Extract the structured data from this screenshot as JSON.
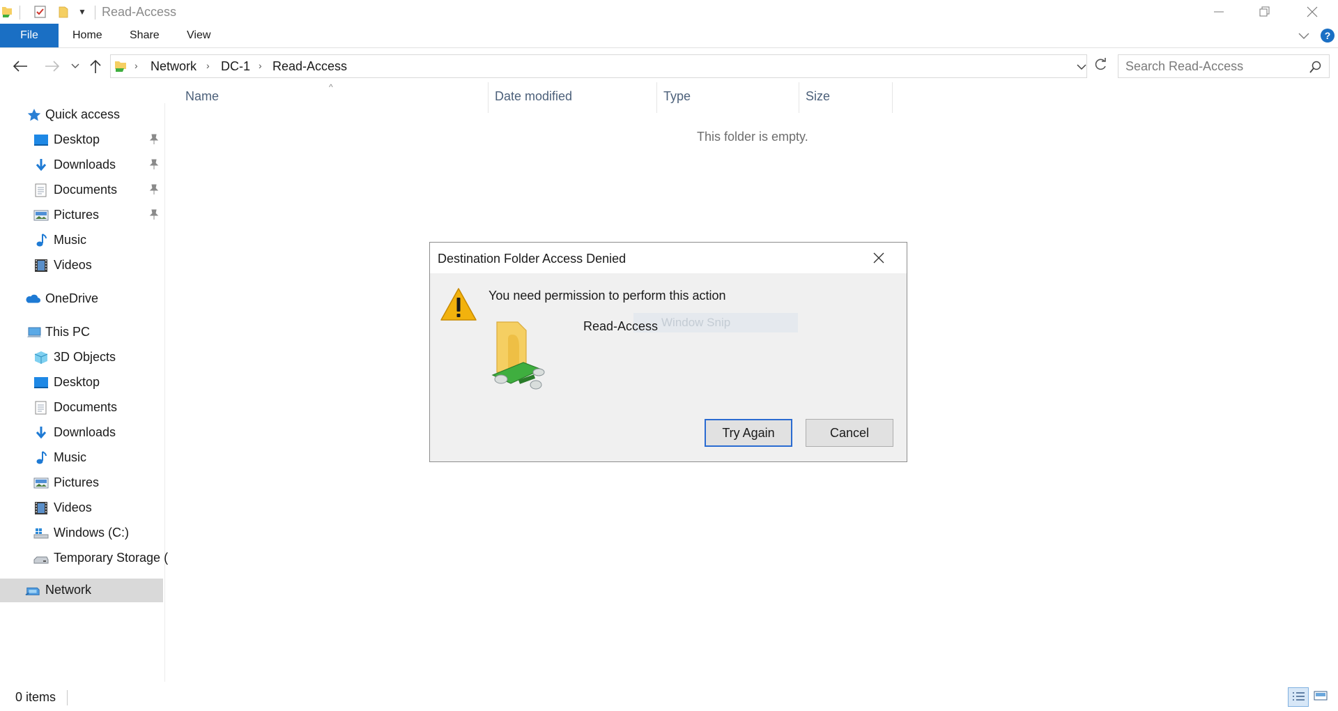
{
  "window": {
    "title": "Read-Access",
    "controls": [
      "minimize-icon",
      "restore-icon",
      "close-icon"
    ]
  },
  "ribbon": {
    "tabs": [
      "File",
      "Home",
      "Share",
      "View"
    ]
  },
  "address": {
    "crumbs": [
      "Network",
      "DC-1",
      "Read-Access"
    ],
    "search_placeholder": "Search Read-Access"
  },
  "sidebar": {
    "quick_access": "Quick access",
    "quick_items": [
      "Desktop",
      "Downloads",
      "Documents",
      "Pictures",
      "Music",
      "Videos"
    ],
    "onedrive": "OneDrive",
    "this_pc": "This PC",
    "pc_items": [
      "3D Objects",
      "Desktop",
      "Documents",
      "Downloads",
      "Music",
      "Pictures",
      "Videos",
      "Windows (C:)",
      "Temporary Storage ("
    ],
    "network": "Network"
  },
  "columns": [
    "Name",
    "Date modified",
    "Type",
    "Size"
  ],
  "content": {
    "empty_message": "This folder is empty."
  },
  "status": {
    "item_count": "0 items"
  },
  "dialog": {
    "title": "Destination Folder Access Denied",
    "message": "You need permission to perform this action",
    "folder_name": "Read-Access",
    "ghost_text": "Window Snip",
    "try_again_label": "Try Again",
    "cancel_label": "Cancel"
  },
  "colors": {
    "accent": "#1a6fc4",
    "warning": "#f2b20d",
    "folder": "#f5cf62",
    "network_pipe": "#3fae3f"
  }
}
